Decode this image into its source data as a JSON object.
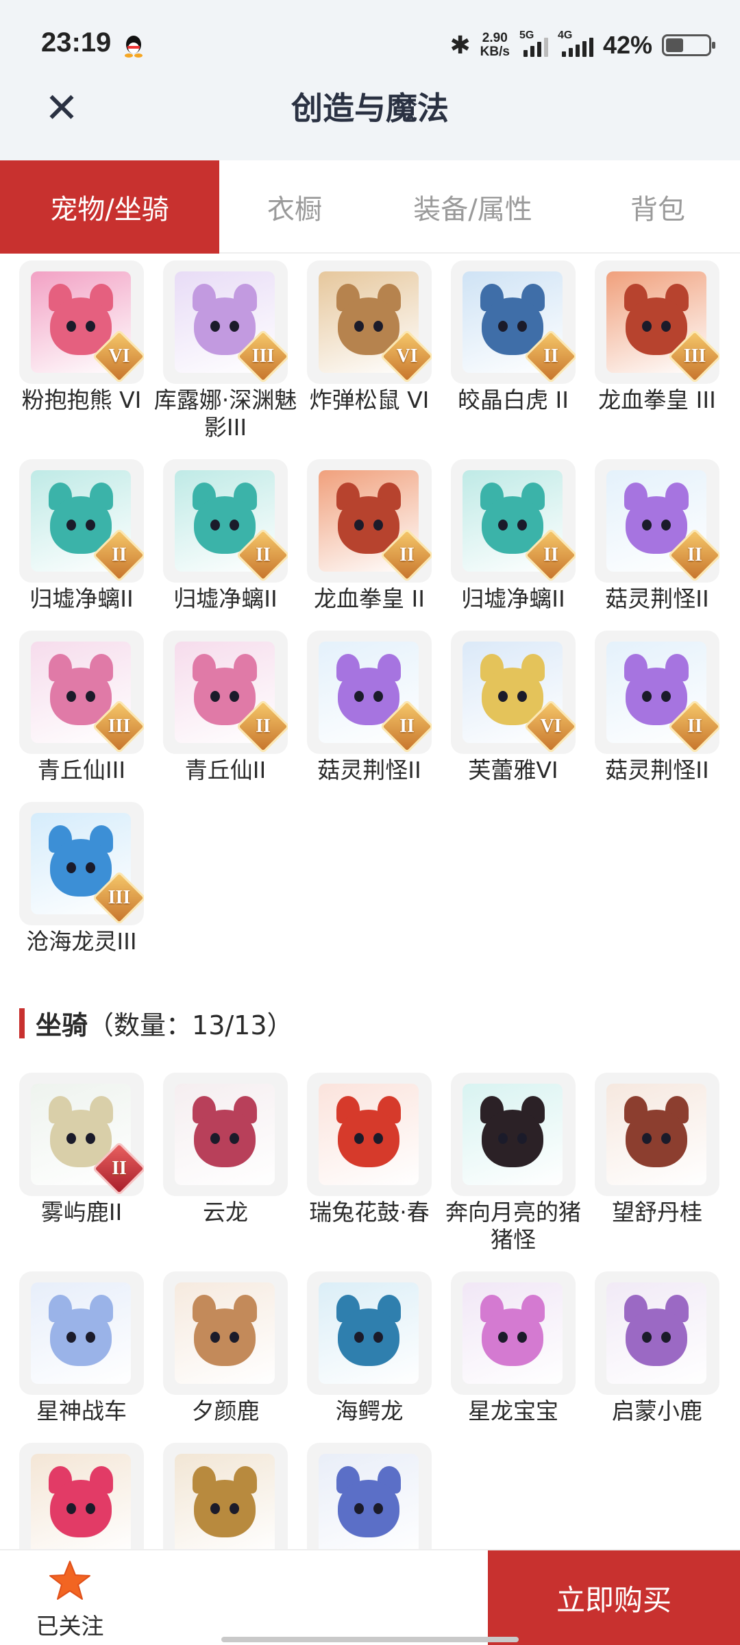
{
  "status_bar": {
    "time": "23:19",
    "net_speed_value": "2.90",
    "net_speed_unit": "KB/s",
    "sim1_label": "5G",
    "sim2_label": "4G",
    "battery_percent": "42%",
    "battery_level": 0.42
  },
  "header": {
    "title": "创造与魔法",
    "close_icon": "close-icon"
  },
  "tabs": [
    {
      "label": "宠物/坐骑",
      "active": true
    },
    {
      "label": "衣橱",
      "active": false
    },
    {
      "label": "装备/属性",
      "active": false
    },
    {
      "label": "背包",
      "active": false
    }
  ],
  "pets": [
    {
      "name": "粉抱抱熊 VI",
      "rank": "VI"
    },
    {
      "name": "库露娜·深渊魅影III",
      "rank": "III"
    },
    {
      "name": "炸弹松鼠 VI",
      "rank": "VI"
    },
    {
      "name": "皎晶白虎 II",
      "rank": "II"
    },
    {
      "name": "龙血拳皇 III",
      "rank": "III"
    },
    {
      "name": "归墟净螭II",
      "rank": "II"
    },
    {
      "name": "归墟净螭II",
      "rank": "II"
    },
    {
      "name": "龙血拳皇 II",
      "rank": "II"
    },
    {
      "name": "归墟净螭II",
      "rank": "II"
    },
    {
      "name": "菇灵荆怪II",
      "rank": "II"
    },
    {
      "name": "青丘仙III",
      "rank": "III"
    },
    {
      "name": "青丘仙II",
      "rank": "II"
    },
    {
      "name": "菇灵荆怪II",
      "rank": "II"
    },
    {
      "name": "芙蕾雅VI",
      "rank": "VI"
    },
    {
      "name": "菇灵荆怪II",
      "rank": "II"
    },
    {
      "name": "沧海龙灵III",
      "rank": "III"
    }
  ],
  "mounts_section": {
    "title": "坐骑",
    "count_text": "（数量：13/13）"
  },
  "mounts": [
    {
      "name": "雾屿鹿II",
      "rank": "II"
    },
    {
      "name": "云龙",
      "rank": ""
    },
    {
      "name": "瑞兔花鼓·春",
      "rank": ""
    },
    {
      "name": "奔向月亮的猪猪怪",
      "rank": ""
    },
    {
      "name": "望舒丹桂",
      "rank": ""
    },
    {
      "name": "星神战车",
      "rank": ""
    },
    {
      "name": "夕颜鹿",
      "rank": ""
    },
    {
      "name": "海鳄龙",
      "rank": ""
    },
    {
      "name": "星龙宝宝",
      "rank": ""
    },
    {
      "name": "启蒙小鹿",
      "rank": ""
    },
    {
      "name": "",
      "rank": ""
    },
    {
      "name": "",
      "rank": ""
    },
    {
      "name": "",
      "rank": ""
    }
  ],
  "bottom_bar": {
    "follow_label": "已关注",
    "follow_icon": "star-icon",
    "buy_label": "立即购买"
  },
  "colors": {
    "accent": "#c8312f",
    "tab_inactive": "#9a9a9a"
  }
}
